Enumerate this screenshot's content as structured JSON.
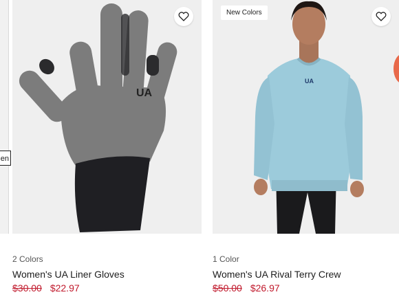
{
  "edge_chip_text": "en",
  "products": [
    {
      "colors_label": "2 Colors",
      "title": "Women's UA Liner Gloves",
      "original_price": "$30.00",
      "sale_price": "$22.97",
      "badge": ""
    },
    {
      "colors_label": "1 Color",
      "title": "Women's UA Rival Terry Crew",
      "original_price": "$50.00",
      "sale_price": "$26.97",
      "badge": "New Colors"
    }
  ],
  "colors": {
    "sale_red": "#c0182b",
    "media_bg": "#efefef",
    "glove_grey": "#7d7d7d",
    "cuff_black": "#1f1f23",
    "sweater_blue": "#9ccbdb"
  },
  "icons": {
    "favorite": "heart-outline-icon"
  }
}
